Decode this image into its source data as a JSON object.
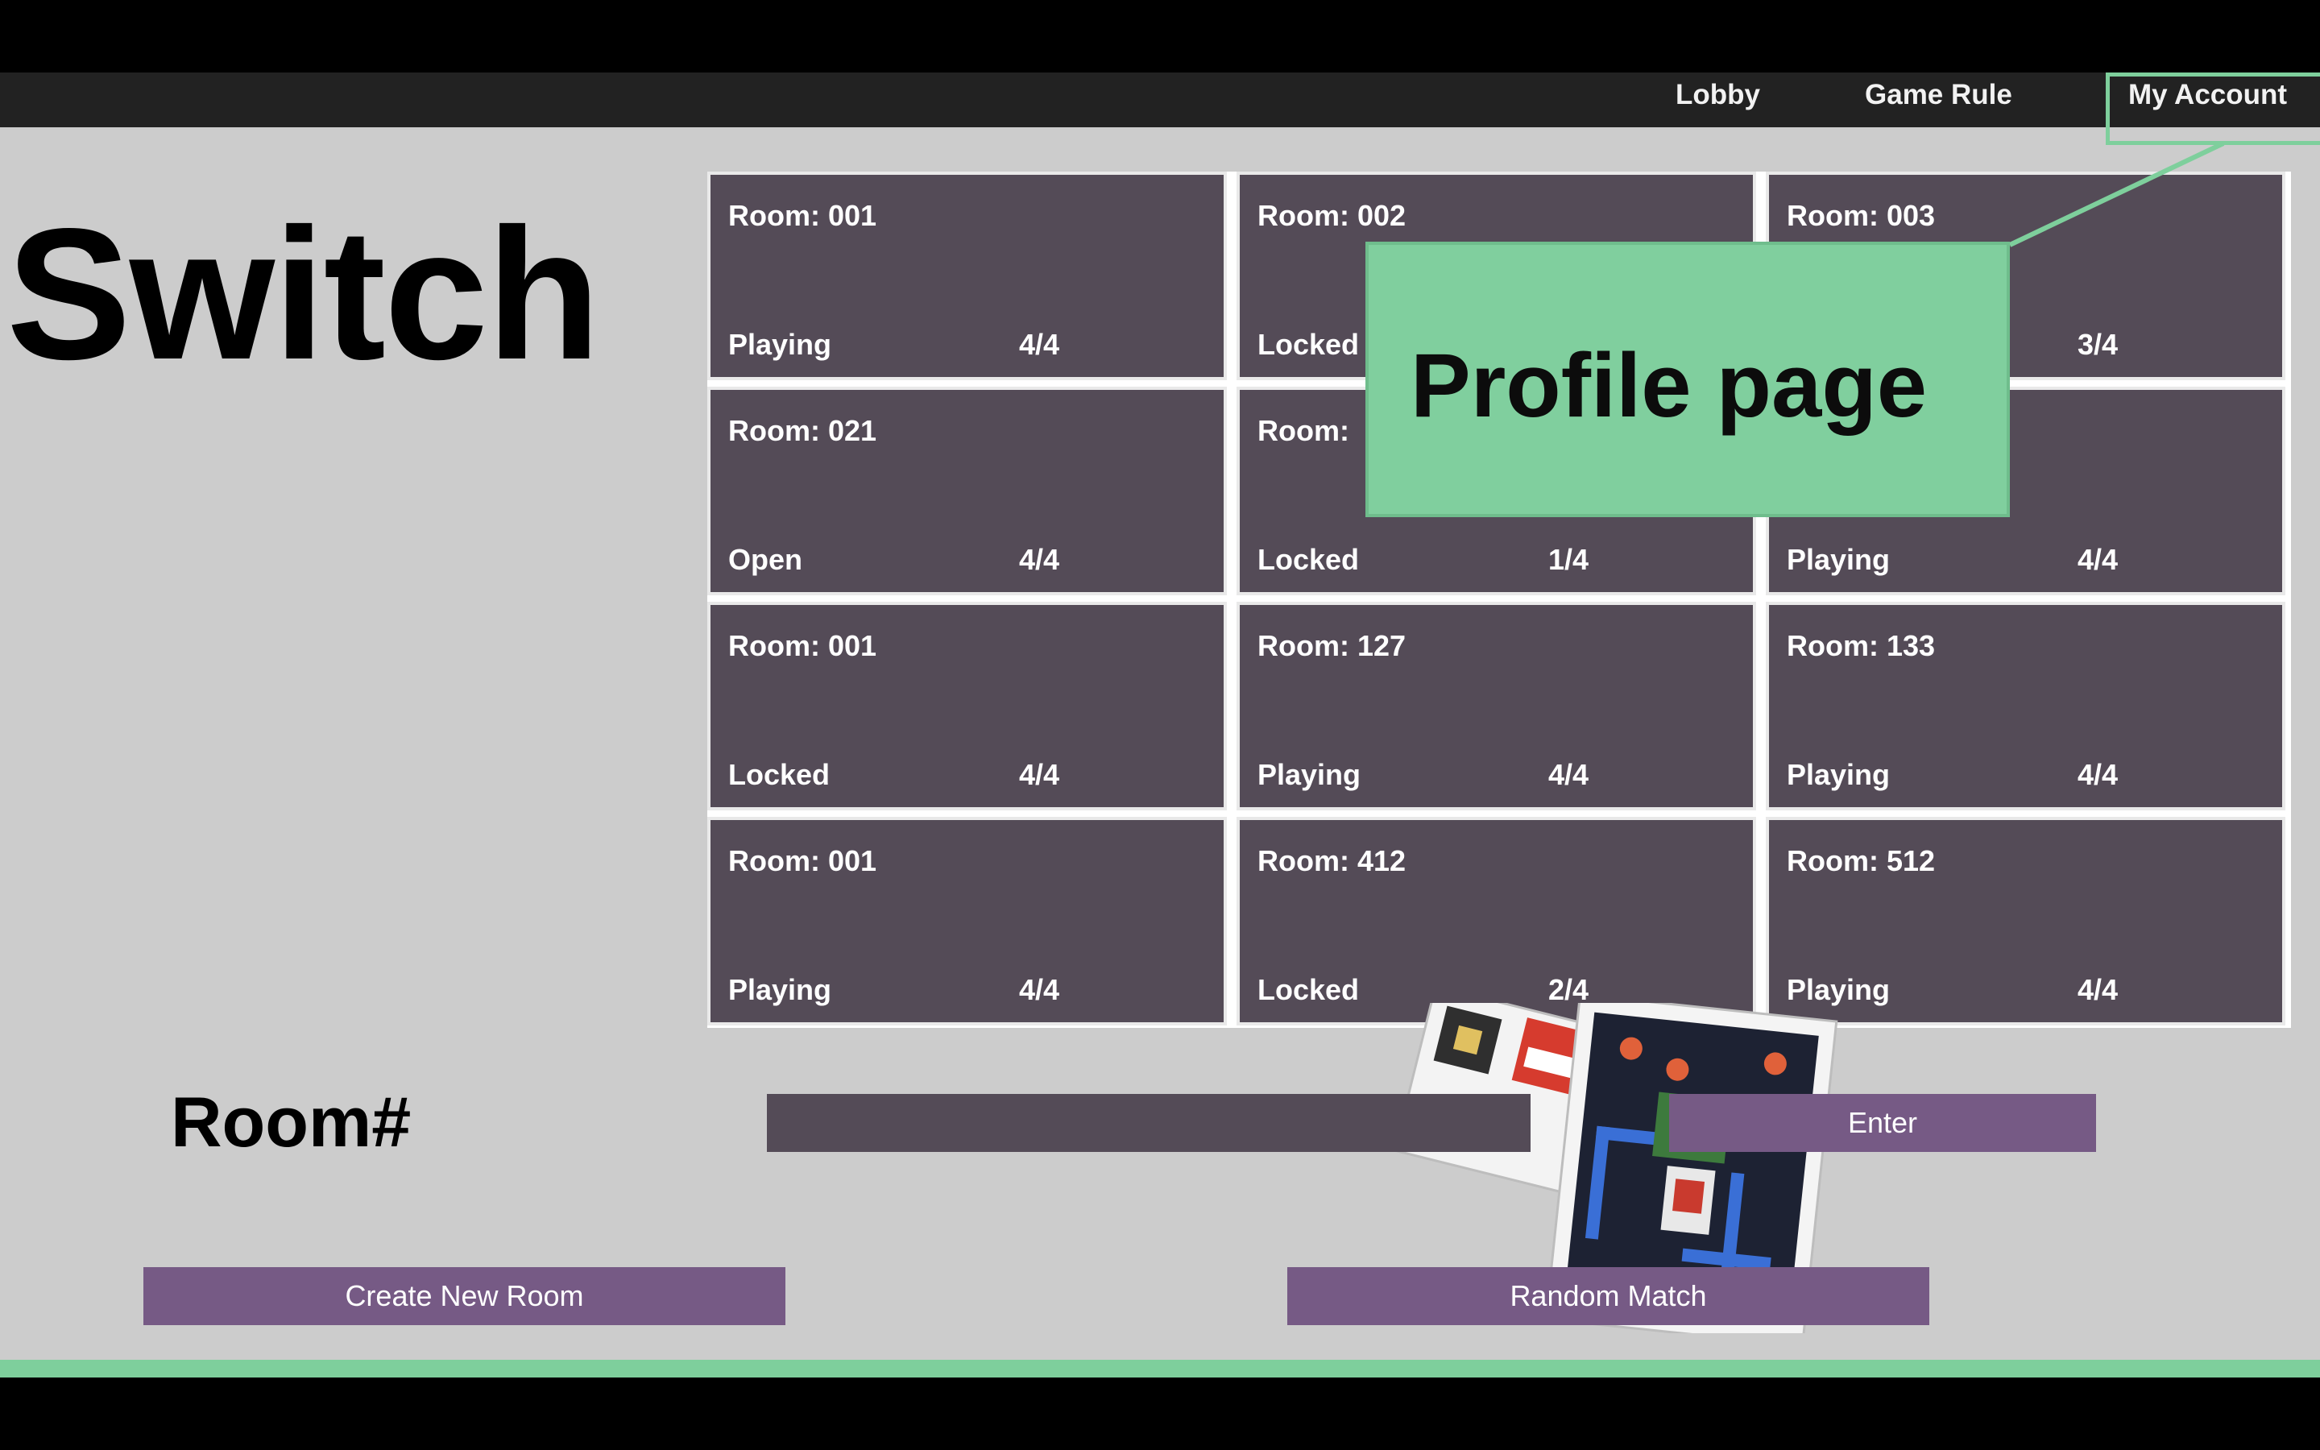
{
  "nav": {
    "items": [
      "Lobby",
      "Game Rule",
      "My Account"
    ]
  },
  "title": "Switch",
  "rooms": [
    {
      "room": "Room: 001",
      "status": "Playing",
      "count": "4/4"
    },
    {
      "room": "Room: 002",
      "status": "Locked",
      "count": ""
    },
    {
      "room": "Room: 003",
      "status": "",
      "count": "3/4"
    },
    {
      "room": "Room: 021",
      "status": "Open",
      "count": "4/4"
    },
    {
      "room": "Room:",
      "status": "Locked",
      "count": "1/4"
    },
    {
      "room": "",
      "status": "Playing",
      "count": "4/4"
    },
    {
      "room": "Room: 001",
      "status": "Locked",
      "count": "4/4"
    },
    {
      "room": "Room: 127",
      "status": "Playing",
      "count": "4/4"
    },
    {
      "room": "Room: 133",
      "status": "Playing",
      "count": "4/4"
    },
    {
      "room": "Room: 001",
      "status": "Playing",
      "count": "4/4"
    },
    {
      "room": "Room: 412",
      "status": "Locked",
      "count": "2/4"
    },
    {
      "room": "Room: 512",
      "status": "Playing",
      "count": "4/4"
    }
  ],
  "room_entry": {
    "label": "Room#",
    "input_value": "",
    "enter_label": "Enter"
  },
  "actions": {
    "create_label": "Create New Room",
    "random_label": "Random Match"
  },
  "callout": {
    "text": "Profile page"
  },
  "colors": {
    "tile": "#544b57",
    "button": "#765a85",
    "callout": "#80cf9e",
    "navbar": "#222222",
    "background": "#cccccc"
  }
}
